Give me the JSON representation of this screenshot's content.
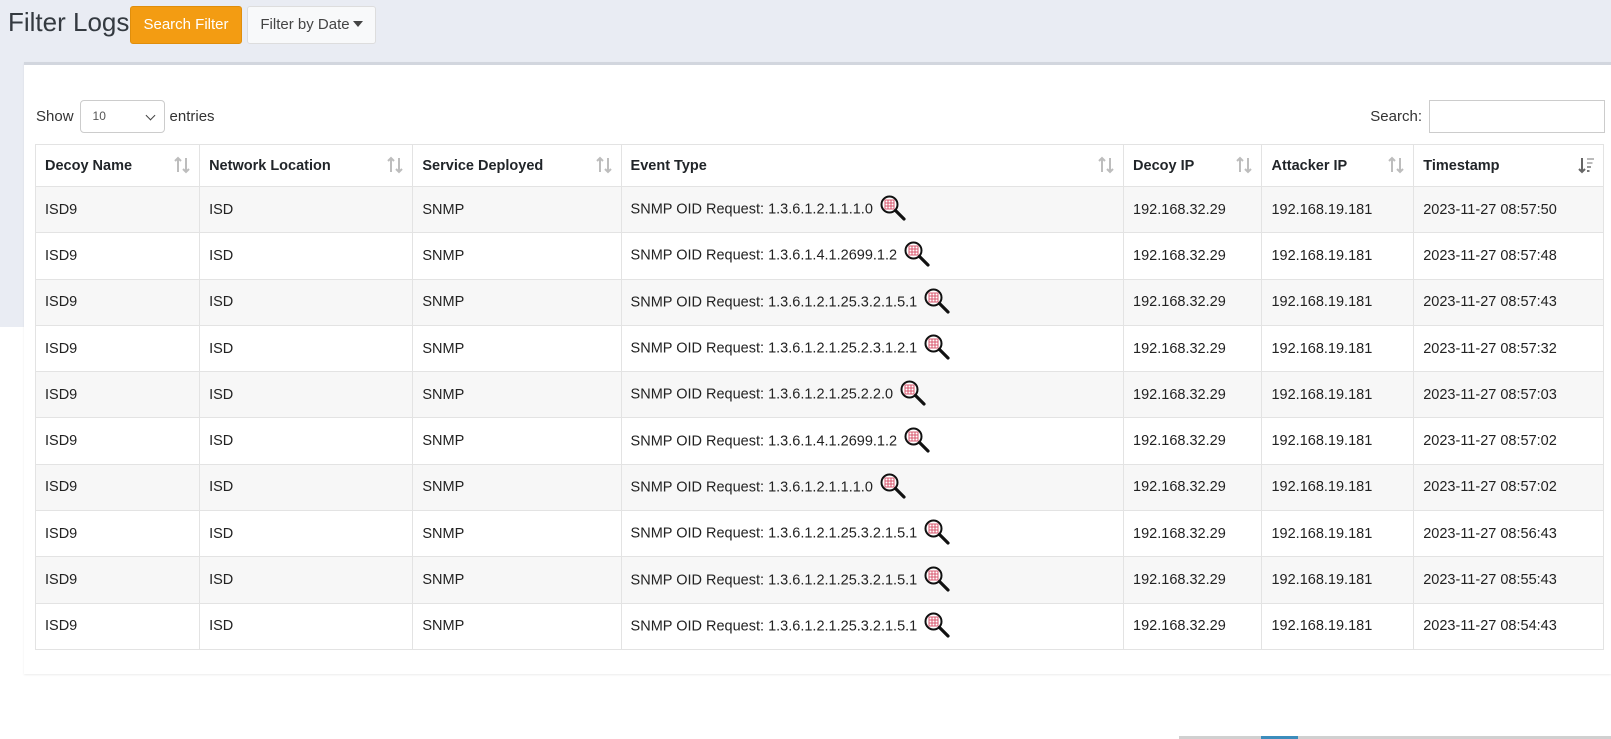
{
  "header": {
    "title": "Filter Logs",
    "search_filter_label": "Search Filter",
    "filter_by_date_label": "Filter by Date"
  },
  "controls": {
    "show_label": "Show",
    "entries_value": "10",
    "entries_label": "entries",
    "search_label": "Search:",
    "search_value": ""
  },
  "table": {
    "columns": [
      {
        "label": "Decoy Name",
        "sort": "none"
      },
      {
        "label": "Network Location",
        "sort": "none"
      },
      {
        "label": "Service Deployed",
        "sort": "none"
      },
      {
        "label": "Event Type",
        "sort": "none"
      },
      {
        "label": "Decoy IP",
        "sort": "none"
      },
      {
        "label": "Attacker IP",
        "sort": "none"
      },
      {
        "label": "Timestamp",
        "sort": "descending"
      }
    ],
    "rows": [
      {
        "decoy_name": "ISD9",
        "network_location": "ISD",
        "service": "SNMP",
        "event_type": "SNMP OID Request: 1.3.6.1.2.1.1.1.0",
        "decoy_ip": "192.168.32.29",
        "attacker_ip": "192.168.19.181",
        "timestamp": "2023-11-27 08:57:50"
      },
      {
        "decoy_name": "ISD9",
        "network_location": "ISD",
        "service": "SNMP",
        "event_type": "SNMP OID Request: 1.3.6.1.4.1.2699.1.2",
        "decoy_ip": "192.168.32.29",
        "attacker_ip": "192.168.19.181",
        "timestamp": "2023-11-27 08:57:48"
      },
      {
        "decoy_name": "ISD9",
        "network_location": "ISD",
        "service": "SNMP",
        "event_type": "SNMP OID Request: 1.3.6.1.2.1.25.3.2.1.5.1",
        "decoy_ip": "192.168.32.29",
        "attacker_ip": "192.168.19.181",
        "timestamp": "2023-11-27 08:57:43"
      },
      {
        "decoy_name": "ISD9",
        "network_location": "ISD",
        "service": "SNMP",
        "event_type": "SNMP OID Request: 1.3.6.1.2.1.25.2.3.1.2.1",
        "decoy_ip": "192.168.32.29",
        "attacker_ip": "192.168.19.181",
        "timestamp": "2023-11-27 08:57:32"
      },
      {
        "decoy_name": "ISD9",
        "network_location": "ISD",
        "service": "SNMP",
        "event_type": "SNMP OID Request: 1.3.6.1.2.1.25.2.2.0",
        "decoy_ip": "192.168.32.29",
        "attacker_ip": "192.168.19.181",
        "timestamp": "2023-11-27 08:57:03"
      },
      {
        "decoy_name": "ISD9",
        "network_location": "ISD",
        "service": "SNMP",
        "event_type": "SNMP OID Request: 1.3.6.1.4.1.2699.1.2",
        "decoy_ip": "192.168.32.29",
        "attacker_ip": "192.168.19.181",
        "timestamp": "2023-11-27 08:57:02"
      },
      {
        "decoy_name": "ISD9",
        "network_location": "ISD",
        "service": "SNMP",
        "event_type": "SNMP OID Request: 1.3.6.1.2.1.1.1.0",
        "decoy_ip": "192.168.32.29",
        "attacker_ip": "192.168.19.181",
        "timestamp": "2023-11-27 08:57:02"
      },
      {
        "decoy_name": "ISD9",
        "network_location": "ISD",
        "service": "SNMP",
        "event_type": "SNMP OID Request: 1.3.6.1.2.1.25.3.2.1.5.1",
        "decoy_ip": "192.168.32.29",
        "attacker_ip": "192.168.19.181",
        "timestamp": "2023-11-27 08:56:43"
      },
      {
        "decoy_name": "ISD9",
        "network_location": "ISD",
        "service": "SNMP",
        "event_type": "SNMP OID Request: 1.3.6.1.2.1.25.3.2.1.5.1",
        "decoy_ip": "192.168.32.29",
        "attacker_ip": "192.168.19.181",
        "timestamp": "2023-11-27 08:55:43"
      },
      {
        "decoy_name": "ISD9",
        "network_location": "ISD",
        "service": "SNMP",
        "event_type": "SNMP OID Request: 1.3.6.1.2.1.25.3.2.1.5.1",
        "decoy_ip": "192.168.32.29",
        "attacker_ip": "192.168.19.181",
        "timestamp": "2023-11-27 08:54:43"
      }
    ]
  },
  "icons": {
    "details": "magnifier-details-icon",
    "sort": "sort-arrows-icon",
    "sort_desc": "sort-descending-icon"
  },
  "colors": {
    "primary_button": "#f39c12",
    "page_background": "#e9ecf3",
    "striped_row": "#f7f7f7"
  }
}
